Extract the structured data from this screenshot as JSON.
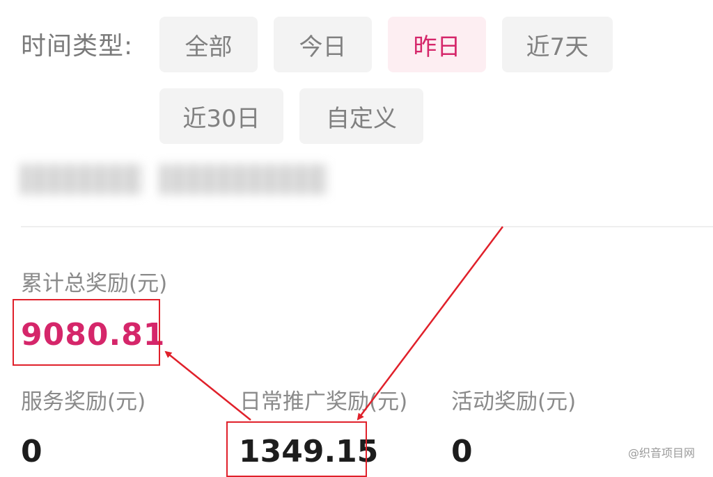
{
  "filter": {
    "label": "时间类型:",
    "chips": [
      {
        "label": "全部",
        "active": false
      },
      {
        "label": "今日",
        "active": false
      },
      {
        "label": "昨日",
        "active": true
      },
      {
        "label": "近7天",
        "active": false
      },
      {
        "label": "近30日",
        "active": false
      },
      {
        "label": "自定义",
        "active": false
      }
    ]
  },
  "stats": {
    "total": {
      "label": "累计总奖励(元)",
      "value": "9080.81"
    },
    "service": {
      "label": "服务奖励(元)",
      "value": "0"
    },
    "daily": {
      "label": "日常推广奖励(元)",
      "value": "1349.15"
    },
    "activity": {
      "label": "活动奖励(元)",
      "value": "0"
    }
  },
  "watermark": "@织音项目网",
  "colors": {
    "accent": "#d5266a",
    "active_chip_bg": "#fdeef2",
    "chip_bg": "#f3f3f3",
    "annotation": "#e0202a"
  }
}
